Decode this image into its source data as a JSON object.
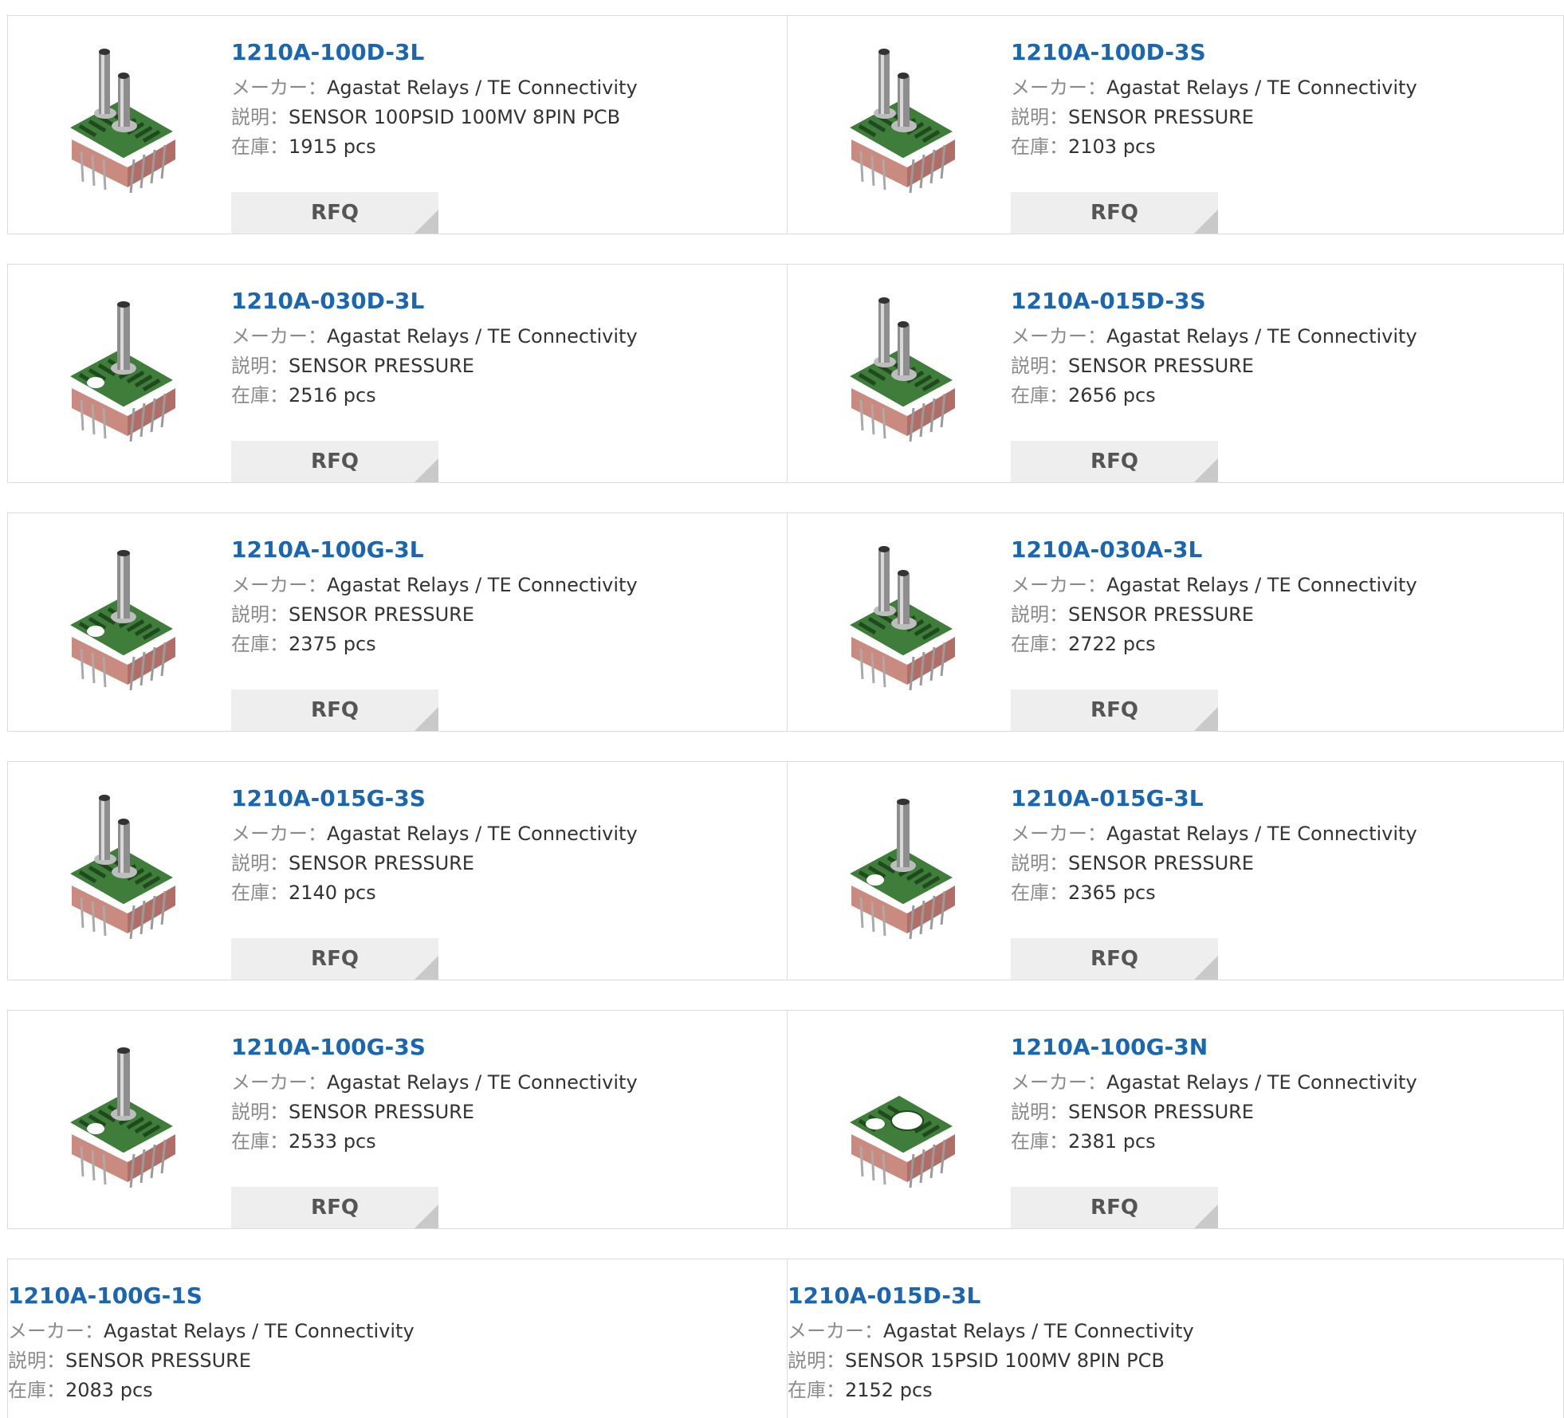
{
  "labels": {
    "maker": "メーカー",
    "desc": "説明",
    "stock": "在庫",
    "rfq": "RFQ"
  },
  "products": [
    {
      "pn": "1210A-100D-3L",
      "maker": "Agastat Relays / TE Connectivity",
      "desc": "SENSOR 100PSID 100MV 8PIN PCB",
      "stock": "1915 pcs",
      "image": "dual-port"
    },
    {
      "pn": "1210A-100D-3S",
      "maker": "Agastat Relays / TE Connectivity",
      "desc": "SENSOR PRESSURE",
      "stock": "2103 pcs",
      "image": "dual-port"
    },
    {
      "pn": "1210A-030D-3L",
      "maker": "Agastat Relays / TE Connectivity",
      "desc": "SENSOR PRESSURE",
      "stock": "2516 pcs",
      "image": "single-port"
    },
    {
      "pn": "1210A-015D-3S",
      "maker": "Agastat Relays / TE Connectivity",
      "desc": "SENSOR PRESSURE",
      "stock": "2656 pcs",
      "image": "dual-port"
    },
    {
      "pn": "1210A-100G-3L",
      "maker": "Agastat Relays / TE Connectivity",
      "desc": "SENSOR PRESSURE",
      "stock": "2375 pcs",
      "image": "single-port"
    },
    {
      "pn": "1210A-030A-3L",
      "maker": "Agastat Relays / TE Connectivity",
      "desc": "SENSOR PRESSURE",
      "stock": "2722 pcs",
      "image": "dual-port"
    },
    {
      "pn": "1210A-015G-3S",
      "maker": "Agastat Relays / TE Connectivity",
      "desc": "SENSOR PRESSURE",
      "stock": "2140 pcs",
      "image": "dual-port"
    },
    {
      "pn": "1210A-015G-3L",
      "maker": "Agastat Relays / TE Connectivity",
      "desc": "SENSOR PRESSURE",
      "stock": "2365 pcs",
      "image": "single-port"
    },
    {
      "pn": "1210A-100G-3S",
      "maker": "Agastat Relays / TE Connectivity",
      "desc": "SENSOR PRESSURE",
      "stock": "2533 pcs",
      "image": "single-port"
    },
    {
      "pn": "1210A-100G-3N",
      "maker": "Agastat Relays / TE Connectivity",
      "desc": "SENSOR PRESSURE",
      "stock": "2381 pcs",
      "image": "no-port"
    },
    {
      "pn": "1210A-100G-1S",
      "maker": "Agastat Relays / TE Connectivity",
      "desc": "SENSOR PRESSURE",
      "stock": "2083 pcs",
      "image": ""
    },
    {
      "pn": "1210A-015D-3L",
      "maker": "Agastat Relays / TE Connectivity",
      "desc": "SENSOR 15PSID 100MV 8PIN PCB",
      "stock": "2152 pcs",
      "image": ""
    }
  ],
  "colors": {
    "link": "#1a66b0",
    "pcb": "#3f7d3a",
    "pcb_dark": "#1f4a1e",
    "base": "#c98a80"
  }
}
